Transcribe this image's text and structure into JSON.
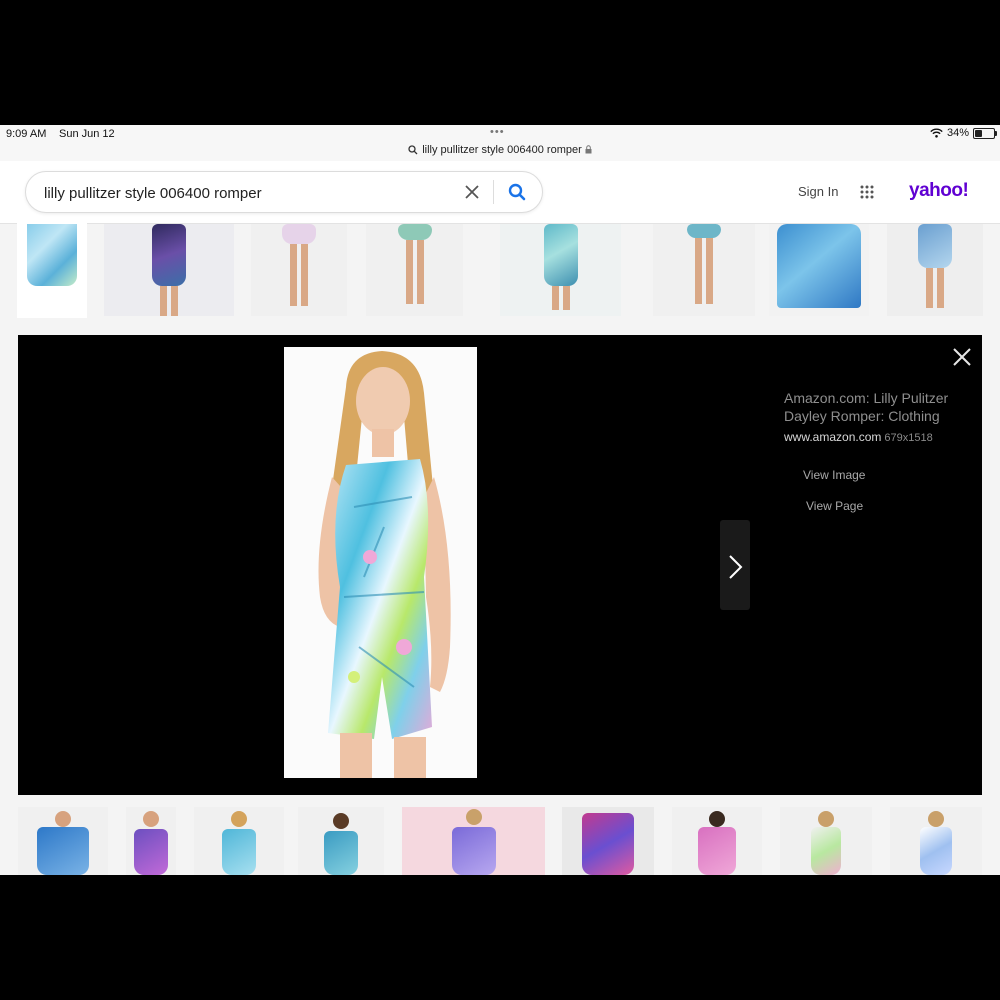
{
  "status_bar": {
    "time": "9:09 AM",
    "date": "Sun Jun 12",
    "url": "lilly pullitzer style 006400 romper",
    "battery": "34%",
    "battery_level": 0.34
  },
  "search": {
    "query": "lilly pullitzer style 006400 romper"
  },
  "header": {
    "sign_in": "Sign In",
    "logo": "yahoo!"
  },
  "preview": {
    "title": "Amazon.com: Lilly Pulitzer Dayley Romper: Clothing",
    "source": "www.amazon.com",
    "dimensions": "679x1518",
    "view_image": "View Image",
    "view_page": "View Page"
  },
  "colors": {
    "brand": "#6001d2",
    "search_icon": "#1a73e8",
    "modal_bg": "#000000"
  }
}
